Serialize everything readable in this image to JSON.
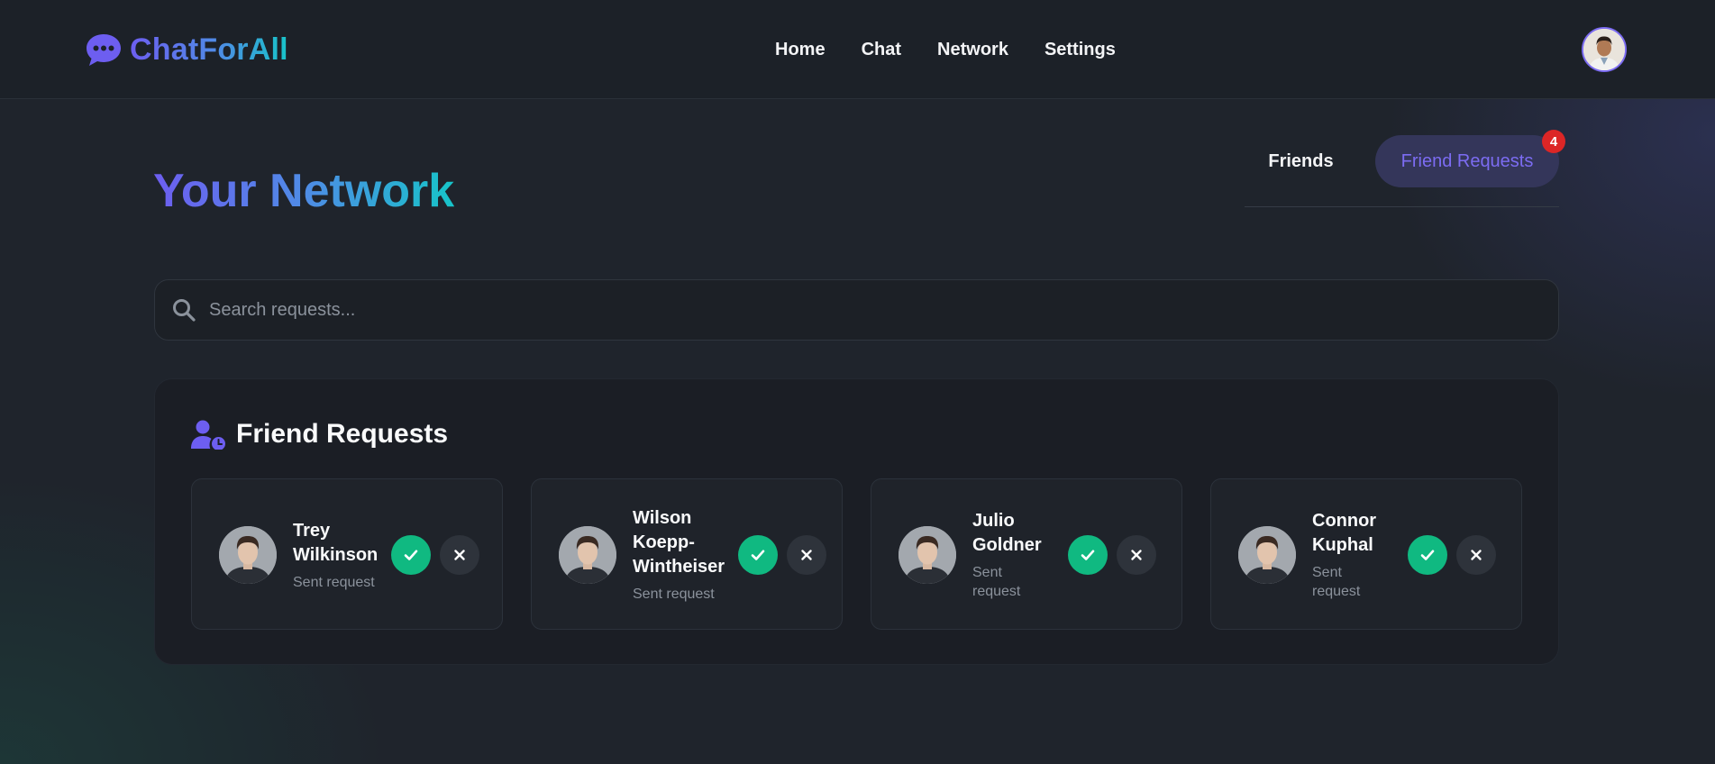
{
  "brand": {
    "name": "ChatForAll"
  },
  "nav": {
    "items": [
      "Home",
      "Chat",
      "Network",
      "Settings"
    ]
  },
  "page": {
    "title": "Your Network"
  },
  "tabs": {
    "friends": "Friends",
    "requests": "Friend Requests",
    "requests_count": "4"
  },
  "search": {
    "placeholder": "Search requests..."
  },
  "section": {
    "title": "Friend Requests"
  },
  "requests": [
    {
      "name_lines": [
        "Trey",
        "Wilkinson"
      ],
      "status_lines": [
        "Sent request"
      ]
    },
    {
      "name_lines": [
        "Wilson",
        "Koepp-",
        "Wintheiser"
      ],
      "status_lines": [
        "Sent request"
      ]
    },
    {
      "name_lines": [
        "Julio",
        "Goldner"
      ],
      "status_lines": [
        "Sent",
        "request"
      ]
    },
    {
      "name_lines": [
        "Connor",
        "Kuphal"
      ],
      "status_lines": [
        "Sent",
        "request"
      ]
    }
  ],
  "colors": {
    "accent": "#7c6cf2",
    "accept": "#10b981",
    "badge": "#dc2626"
  }
}
